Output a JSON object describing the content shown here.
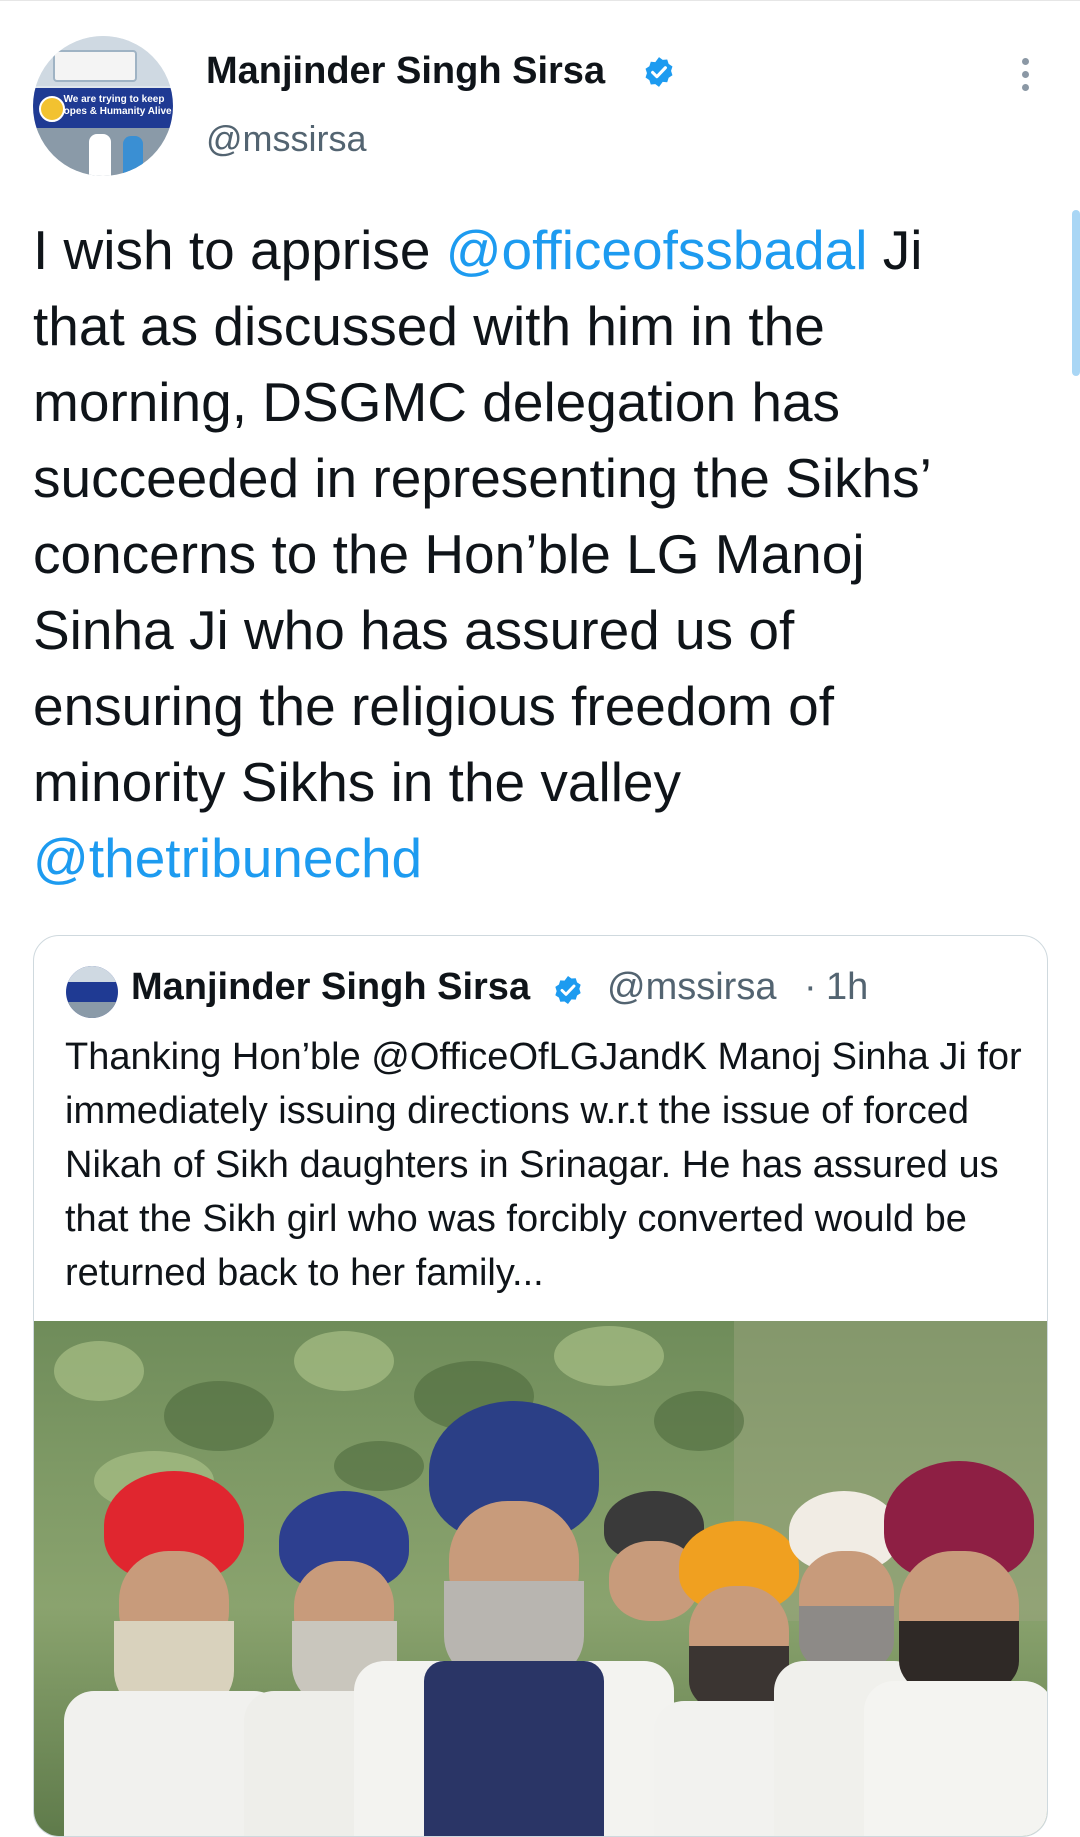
{
  "author": {
    "name": "Manjinder Singh Sirsa",
    "handle": "@mssirsa",
    "avatar_banner_text": "We are trying to keep Hopes & Humanity Alive"
  },
  "tweet": {
    "parts": [
      {
        "text": "I wish to apprise ",
        "type": "text"
      },
      {
        "text": "@officeofssbadal",
        "type": "mention"
      },
      {
        "text": " Ji that as discussed with him in the morning, DSGMC delegation has succeeded in representing the Sikhs’ concerns to the Hon’ble LG Manoj Sinha Ji who has assured us of ensuring the religious freedom of minority Sikhs in the valley ",
        "type": "text"
      },
      {
        "text": "@thetribunechd",
        "type": "mention"
      }
    ]
  },
  "quote": {
    "name": "Manjinder Singh Sirsa",
    "handle": "@mssirsa",
    "separator": "·",
    "time": "1h",
    "text": "Thanking Hon’ble @OfficeOfLGJandK Manoj Sinha Ji for immediately issuing directions w.r.t the issue of forced Nikah of Sikh daughters in Srinagar. He has assured us that the Sikh girl who was forcibly converted would be returned back to her family..."
  },
  "icons": {
    "verified": "verified-badge-icon",
    "more": "more-vertical-icon"
  },
  "colors": {
    "accent": "#1d9bf0",
    "secondary_text": "#536471",
    "border": "#cfd9de"
  }
}
